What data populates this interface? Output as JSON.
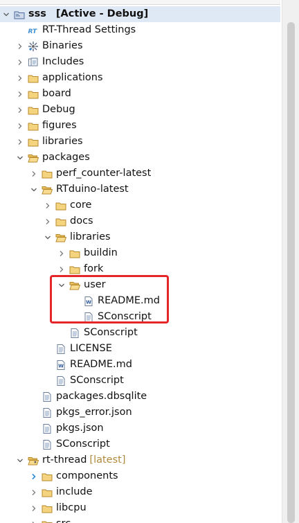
{
  "header": {
    "top_strip": ""
  },
  "tree": {
    "rows": [
      {
        "depth": 0,
        "chev": "down",
        "icon": "project",
        "label": "sss",
        "status": "[Active - Debug]",
        "bold": true,
        "selected": true
      },
      {
        "depth": 1,
        "chev": "none",
        "icon": "rt-settings",
        "label": "RT-Thread Settings"
      },
      {
        "depth": 1,
        "chev": "right",
        "icon": "binaries",
        "label": "Binaries"
      },
      {
        "depth": 1,
        "chev": "right",
        "icon": "includes",
        "label": "Includes"
      },
      {
        "depth": 1,
        "chev": "right",
        "icon": "folder",
        "label": "applications"
      },
      {
        "depth": 1,
        "chev": "right",
        "icon": "folder",
        "label": "board"
      },
      {
        "depth": 1,
        "chev": "right",
        "icon": "folder",
        "label": "Debug"
      },
      {
        "depth": 1,
        "chev": "right",
        "icon": "folder",
        "label": "figures"
      },
      {
        "depth": 1,
        "chev": "right",
        "icon": "folder",
        "label": "libraries"
      },
      {
        "depth": 1,
        "chev": "down",
        "icon": "folder-open",
        "label": "packages"
      },
      {
        "depth": 2,
        "chev": "right",
        "icon": "folder",
        "label": "perf_counter-latest"
      },
      {
        "depth": 2,
        "chev": "down",
        "icon": "folder-open",
        "label": "RTduino-latest"
      },
      {
        "depth": 3,
        "chev": "right",
        "icon": "folder",
        "label": "core"
      },
      {
        "depth": 3,
        "chev": "right",
        "icon": "folder",
        "label": "docs"
      },
      {
        "depth": 3,
        "chev": "down",
        "icon": "folder-open",
        "label": "libraries"
      },
      {
        "depth": 4,
        "chev": "right",
        "icon": "folder",
        "label": "buildin"
      },
      {
        "depth": 4,
        "chev": "right",
        "icon": "folder",
        "label": "fork"
      },
      {
        "depth": 4,
        "chev": "down",
        "icon": "folder-open",
        "label": "user"
      },
      {
        "depth": 5,
        "chev": "none",
        "icon": "word-doc",
        "label": "README.md"
      },
      {
        "depth": 5,
        "chev": "none",
        "icon": "text-file",
        "label": "SConscript"
      },
      {
        "depth": 4,
        "chev": "none",
        "icon": "text-file",
        "label": "SConscript"
      },
      {
        "depth": 3,
        "chev": "none",
        "icon": "text-file",
        "label": "LICENSE"
      },
      {
        "depth": 3,
        "chev": "none",
        "icon": "word-doc",
        "label": "README.md"
      },
      {
        "depth": 3,
        "chev": "none",
        "icon": "text-file",
        "label": "SConscript"
      },
      {
        "depth": 2,
        "chev": "none",
        "icon": "text-file",
        "label": "packages.dbsqlite"
      },
      {
        "depth": 2,
        "chev": "none",
        "icon": "text-file",
        "label": "pkgs_error.json"
      },
      {
        "depth": 2,
        "chev": "none",
        "icon": "text-file",
        "label": "pkgs.json"
      },
      {
        "depth": 2,
        "chev": "none",
        "icon": "text-file",
        "label": "SConscript"
      },
      {
        "depth": 1,
        "chev": "down",
        "icon": "folder-link",
        "label": "rt-thread",
        "decoration": "[latest]"
      },
      {
        "depth": 2,
        "chev": "right-blue",
        "icon": "folder",
        "label": "components"
      },
      {
        "depth": 2,
        "chev": "right",
        "icon": "folder",
        "label": "include"
      },
      {
        "depth": 2,
        "chev": "right",
        "icon": "folder",
        "label": "libcpu"
      },
      {
        "depth": 2,
        "chev": "right",
        "icon": "folder",
        "label": "src"
      }
    ]
  },
  "colors": {
    "highlight": "#e5252a",
    "folder_fill": "#f4d47e",
    "folder_stroke": "#b8892c",
    "selection": "#dfe8f5",
    "decoration": "#b08a3c"
  }
}
